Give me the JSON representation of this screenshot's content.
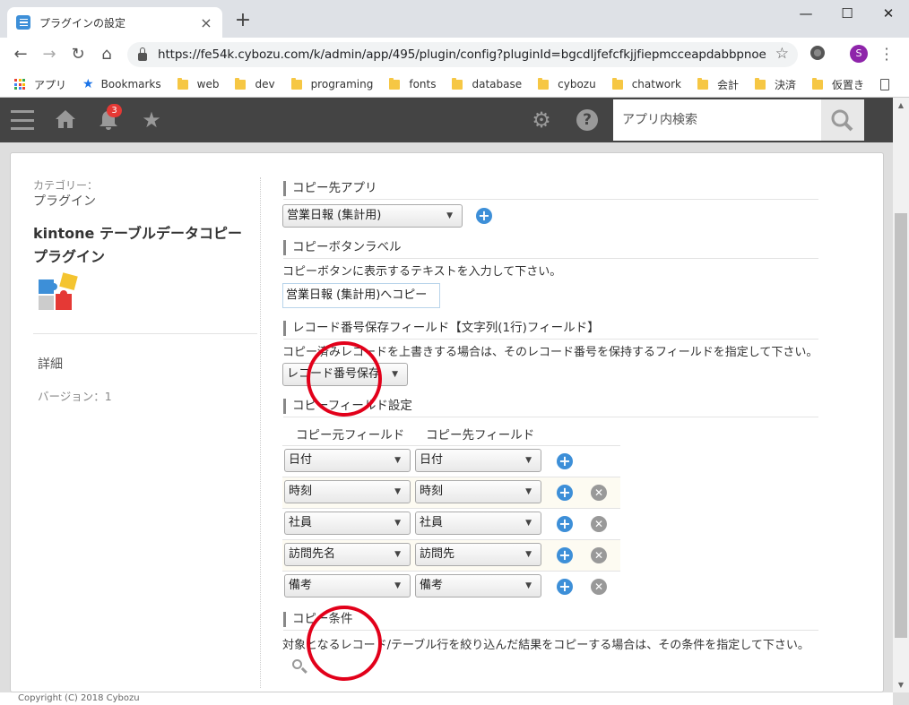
{
  "browser": {
    "tab_title": "プラグインの設定",
    "url": "https://fe54k.cybozu.com/k/admin/app/495/plugin/config?pluginId=bgcdljfefcfkjjfiepmcceapdabbpnoe",
    "avatar_letter": "S",
    "bookmarks": [
      {
        "label": "アプリ",
        "icon": "apps-grid-icon"
      },
      {
        "label": "Bookmarks",
        "icon": "star-icon"
      },
      {
        "label": "web",
        "icon": "folder-icon"
      },
      {
        "label": "dev",
        "icon": "folder-icon"
      },
      {
        "label": "programing",
        "icon": "folder-icon"
      },
      {
        "label": "fonts",
        "icon": "folder-icon"
      },
      {
        "label": "database",
        "icon": "folder-icon"
      },
      {
        "label": "cybozu",
        "icon": "folder-icon"
      },
      {
        "label": "chatwork",
        "icon": "folder-icon"
      },
      {
        "label": "会計",
        "icon": "folder-icon"
      },
      {
        "label": "決済",
        "icon": "folder-icon"
      },
      {
        "label": "仮置き",
        "icon": "folder-icon"
      }
    ]
  },
  "kintone_header": {
    "notification_count": "3",
    "search_placeholder": "アプリ内検索"
  },
  "sidebar": {
    "category_label": "カテゴリー：",
    "category_value": "プラグイン",
    "plugin_title": "kintone テーブルデータコピープラグイン",
    "detail_link": "詳細",
    "version": "バージョン：1"
  },
  "settings": {
    "copy_target_app": {
      "heading": "コピー先アプリ",
      "selected": "営業日報 (集計用)"
    },
    "copy_button_label": {
      "heading": "コピーボタンラベル",
      "description": "コピーボタンに表示するテキストを入力して下さい。",
      "value": "営業日報 (集計用)へコピー"
    },
    "record_number_field": {
      "heading": "レコード番号保存フィールド【文字列(1行)フィールド】",
      "description": "コピー済みレコードを上書きする場合は、そのレコード番号を保持するフィールドを指定して下さい。",
      "selected": "レコード番号保存"
    },
    "copy_fields": {
      "heading": "コピーフィールド設定",
      "col_source": "コピー元フィールド",
      "col_target": "コピー先フィールド",
      "rows": [
        {
          "source": "日付",
          "target": "日付",
          "removable": false
        },
        {
          "source": "時刻",
          "target": "時刻",
          "removable": true
        },
        {
          "source": "社員",
          "target": "社員",
          "removable": true
        },
        {
          "source": "訪問先名",
          "target": "訪問先",
          "removable": true
        },
        {
          "source": "備考",
          "target": "備考",
          "removable": true
        }
      ]
    },
    "copy_conditions": {
      "heading": "コピー条件",
      "description": "対象となるレコード/テーブル行を絞り込んだ結果をコピーする場合は、その条件を指定して下さい。"
    }
  },
  "footer": {
    "copyright": "Copyright (C) 2018 Cybozu"
  },
  "colors": {
    "accent": "#3d8fd8",
    "highlight_circle": "#e2001a",
    "header_bg": "#444444"
  }
}
